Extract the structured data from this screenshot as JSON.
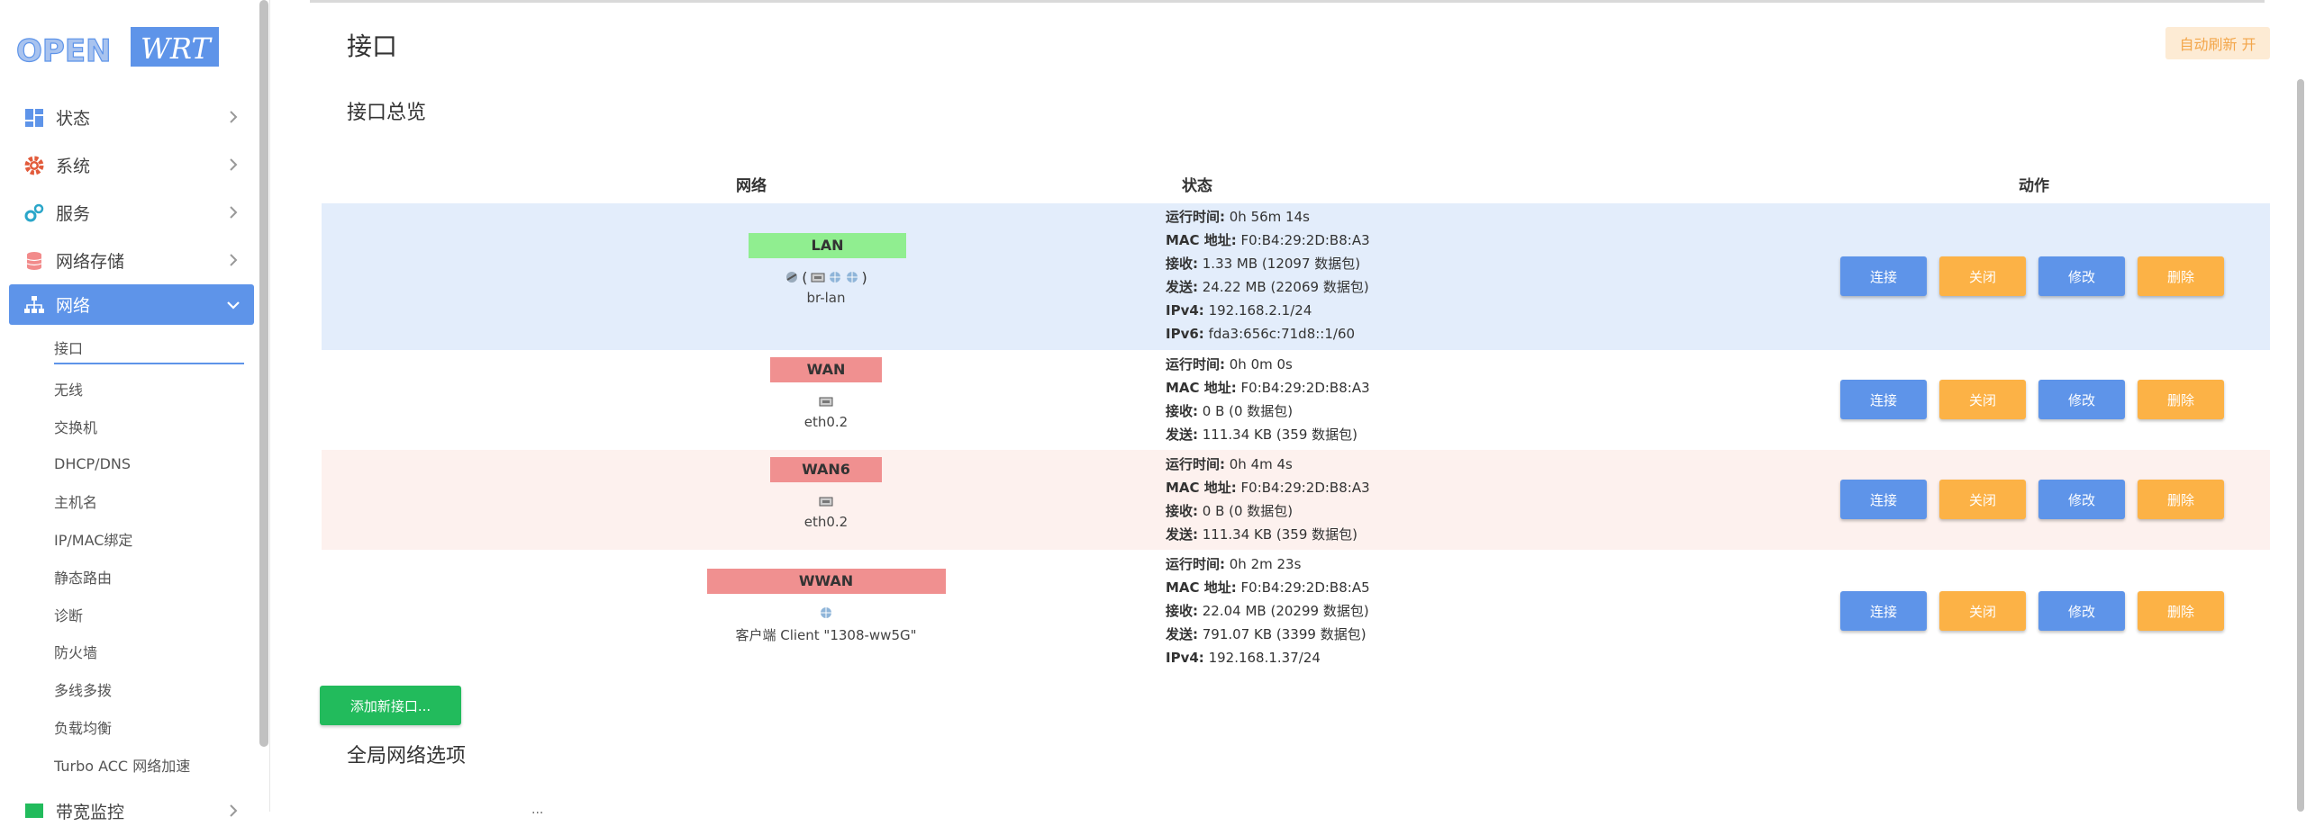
{
  "brand": {
    "open": "OPEN",
    "wrt": "WRT"
  },
  "sidebar": {
    "items": [
      {
        "label": "状态"
      },
      {
        "label": "系统"
      },
      {
        "label": "服务"
      },
      {
        "label": "网络存储"
      },
      {
        "label": "网络"
      }
    ],
    "network_sub": [
      {
        "label": "接口"
      },
      {
        "label": "无线"
      },
      {
        "label": "交换机"
      },
      {
        "label": "DHCP/DNS"
      },
      {
        "label": "主机名"
      },
      {
        "label": "IP/MAC绑定"
      },
      {
        "label": "静态路由"
      },
      {
        "label": "诊断"
      },
      {
        "label": "防火墙"
      },
      {
        "label": "多线多拨"
      },
      {
        "label": "负载均衡"
      },
      {
        "label": "Turbo ACC 网络加速"
      }
    ],
    "bottom_item": {
      "label": "带宽监控"
    }
  },
  "page": {
    "title": "接口",
    "auto_refresh": "自动刷新 开",
    "section_title": "接口总览",
    "global_title": "全局网络选项"
  },
  "table": {
    "headers": {
      "network": "网络",
      "status": "状态",
      "actions": "动作"
    },
    "rows": [
      {
        "name": "LAN",
        "badge_color": "#90ee90",
        "device": "br-lan",
        "device_prefix": "(",
        "device_suffix": ")",
        "status": [
          {
            "k": "运行时间:",
            "v": " 0h 56m 14s"
          },
          {
            "k": "MAC 地址:",
            "v": " F0:B4:29:2D:B8:A3"
          },
          {
            "k": "接收:",
            "v": " 1.33 MB (12097 数据包)"
          },
          {
            "k": "发送:",
            "v": " 24.22 MB (22069 数据包)"
          },
          {
            "k": "IPv4:",
            "v": " 192.168.2.1/24"
          },
          {
            "k": "IPv6:",
            "v": " fda3:656c:71d8::1/60"
          }
        ]
      },
      {
        "name": "WAN",
        "badge_color": "#f09090",
        "device": "eth0.2",
        "status": [
          {
            "k": "运行时间:",
            "v": " 0h 0m 0s"
          },
          {
            "k": "MAC 地址:",
            "v": " F0:B4:29:2D:B8:A3"
          },
          {
            "k": "接收:",
            "v": " 0 B (0 数据包)"
          },
          {
            "k": "发送:",
            "v": " 111.34 KB (359 数据包)"
          }
        ]
      },
      {
        "name": "WAN6",
        "badge_color": "#f09090",
        "device": "eth0.2",
        "status": [
          {
            "k": "运行时间:",
            "v": " 0h 4m 4s"
          },
          {
            "k": "MAC 地址:",
            "v": " F0:B4:29:2D:B8:A3"
          },
          {
            "k": "接收:",
            "v": " 0 B (0 数据包)"
          },
          {
            "k": "发送:",
            "v": " 111.34 KB (359 数据包)"
          }
        ]
      },
      {
        "name": "WWAN",
        "badge_color": "#f09090",
        "device": "客户端 Client \"1308-ww5G\"",
        "status": [
          {
            "k": "运行时间:",
            "v": " 0h 2m 23s"
          },
          {
            "k": "MAC 地址:",
            "v": " F0:B4:29:2D:B8:A5"
          },
          {
            "k": "接收:",
            "v": " 22.04 MB (20299 数据包)"
          },
          {
            "k": "发送:",
            "v": " 791.07 KB (3399 数据包)"
          },
          {
            "k": "IPv4:",
            "v": " 192.168.1.37/24"
          }
        ]
      }
    ],
    "buttons": {
      "connect": "连接",
      "stop": "关闭",
      "edit": "修改",
      "delete": "删除"
    }
  },
  "add_button": "添加新接口...",
  "truncated_line": "...",
  "colors": {
    "accent": "#5e94e9",
    "orange": "#fcb246",
    "green": "#22bb5c",
    "lan_row": "#e3edfb",
    "wan6_row": "#fdf1ee"
  }
}
